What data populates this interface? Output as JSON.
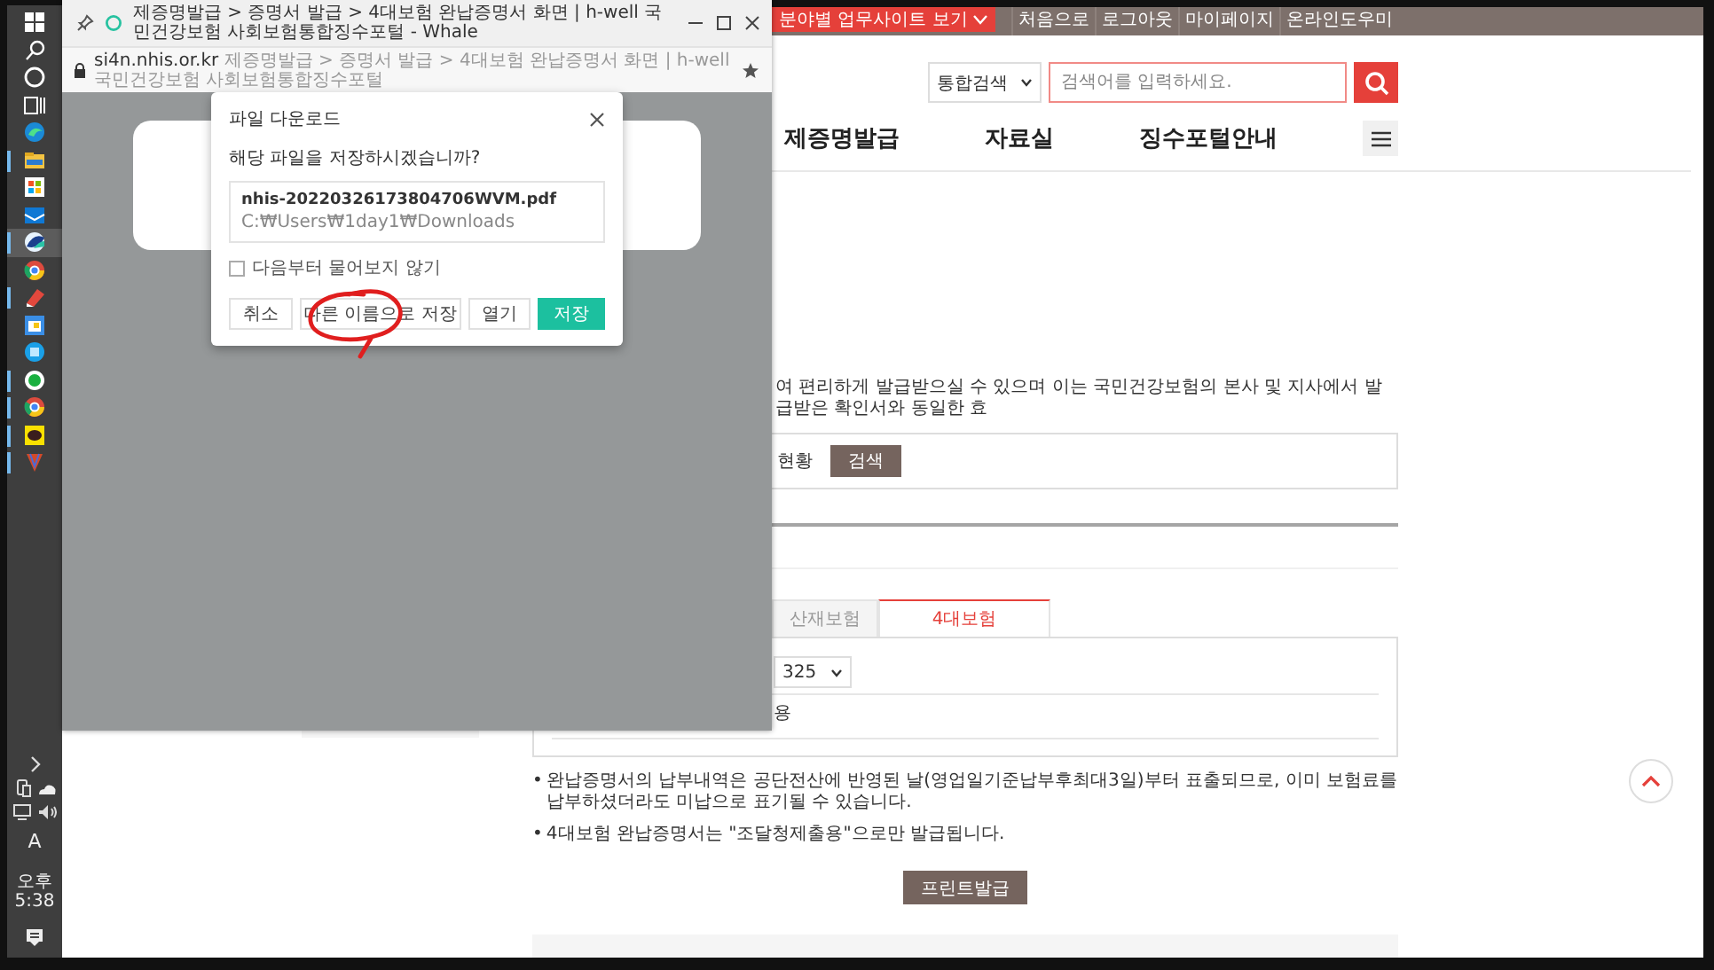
{
  "taskbar": {
    "apps": [
      {
        "running": false,
        "selected": false
      },
      {
        "running": true,
        "selected": false
      },
      {
        "running": false,
        "selected": false
      },
      {
        "running": false,
        "selected": false
      },
      {
        "running": true,
        "selected": true
      },
      {
        "running": false,
        "selected": false
      },
      {
        "running": true,
        "selected": false
      },
      {
        "running": false,
        "selected": false
      },
      {
        "running": false,
        "selected": false
      },
      {
        "running": true,
        "selected": false
      },
      {
        "running": true,
        "selected": false
      },
      {
        "running": true,
        "selected": false
      },
      {
        "running": true,
        "selected": false
      }
    ],
    "ime": "A",
    "clock": "오후 5:38"
  },
  "browser_popup": {
    "title": "제증명발급 > 증명서 발급 > 4대보험 완납증명서 화면 | h-well 국민건강보험 사회보험통합징수포털 - Whale",
    "host": "si4n.nhis.or.kr",
    "page_title": "제증명발급 > 증명서 발급 > 4대보험 완납증명서 화면 | h-well 국민건강보험 사회보험통합징수포털",
    "dialog": {
      "title": "파일 다운로드",
      "question": "해당 파일을 저장하시겠습니까?",
      "file_name": "nhis-20220326173804706WVM.pdf",
      "file_path": "C:₩Users₩1day1₩Downloads",
      "dont_ask": {
        "label": "다음부터 물어보지 않기",
        "checked": false
      },
      "buttons": [
        {
          "label": "취소",
          "kind": "plain"
        },
        {
          "label": "다른 이름으로 저장",
          "kind": "plain"
        },
        {
          "label": "열기",
          "kind": "plain"
        },
        {
          "label": "저장",
          "kind": "primary"
        }
      ]
    }
  },
  "site": {
    "sites_button": "분야별 업무사이트 보기",
    "top_links": [
      "처음으로",
      "로그아웃",
      "마이페이지",
      "온라인도우미"
    ],
    "search": {
      "scope": "통합검색",
      "placeholder": "검색어를 입력하세요."
    },
    "nav": [
      "제증명발급",
      "자료실",
      "징수포털안내"
    ],
    "intro": "여 편리하게 발급받으실 수 있으며 이는 국민건강보험의 본사 및 지사에서 발급받은 확인서와 동일한 효",
    "filter": {
      "label": "현황",
      "button": "검색"
    },
    "tabs": [
      {
        "label": "산재보험",
        "selected": false
      },
      {
        "label": "4대보험",
        "selected": true
      }
    ],
    "panel": {
      "select_value": "325",
      "row_text": "용"
    },
    "notes": [
      {
        "bullet": "•",
        "text": "완납증명서의 납부내역은 공단전산에 반영된 날(영업일기준납부후최대3일)부터 표출되므로, 이미 보험료를 납부하셨더라도 미납으로 표기될 수 있습니다."
      },
      {
        "bullet": "•",
        "text": "4대보험 완납증명서는 \"조달청제출용\"으로만 발급됩니다."
      }
    ],
    "print_button": "프린트발급"
  }
}
